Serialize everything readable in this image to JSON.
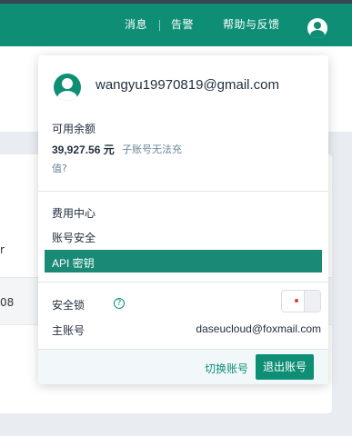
{
  "topbar": {
    "nav_messages": "消息",
    "nav_alerts": "告警",
    "nav_help": "帮助与反馈",
    "user_icon": "user-avatar-icon"
  },
  "dropdown": {
    "email": "wangyu19970819@gmail.com",
    "balance": {
      "label": "可用余额",
      "value": "39,927.56 元",
      "note_line1": "子账号无法充",
      "note_line2": "值?"
    },
    "menu": [
      {
        "label": "费用中心"
      },
      {
        "label": "账号安全"
      },
      {
        "label": "API 密钥"
      }
    ],
    "security_lock": {
      "label": "安全锁",
      "help_icon": "question-circle-icon",
      "help_glyph": "?"
    },
    "main_account": {
      "label": "主账号",
      "value": "daseucloud@foxmail.com"
    },
    "footer": {
      "switch_account": "切换账号",
      "logout": "退出账号"
    }
  },
  "background": {
    "fragment_1": "r",
    "fragment_2": "08"
  },
  "colors": {
    "brand": "#0e8e75",
    "active_menu": "#1a8a76",
    "toggle_dot": "#e4393c"
  }
}
